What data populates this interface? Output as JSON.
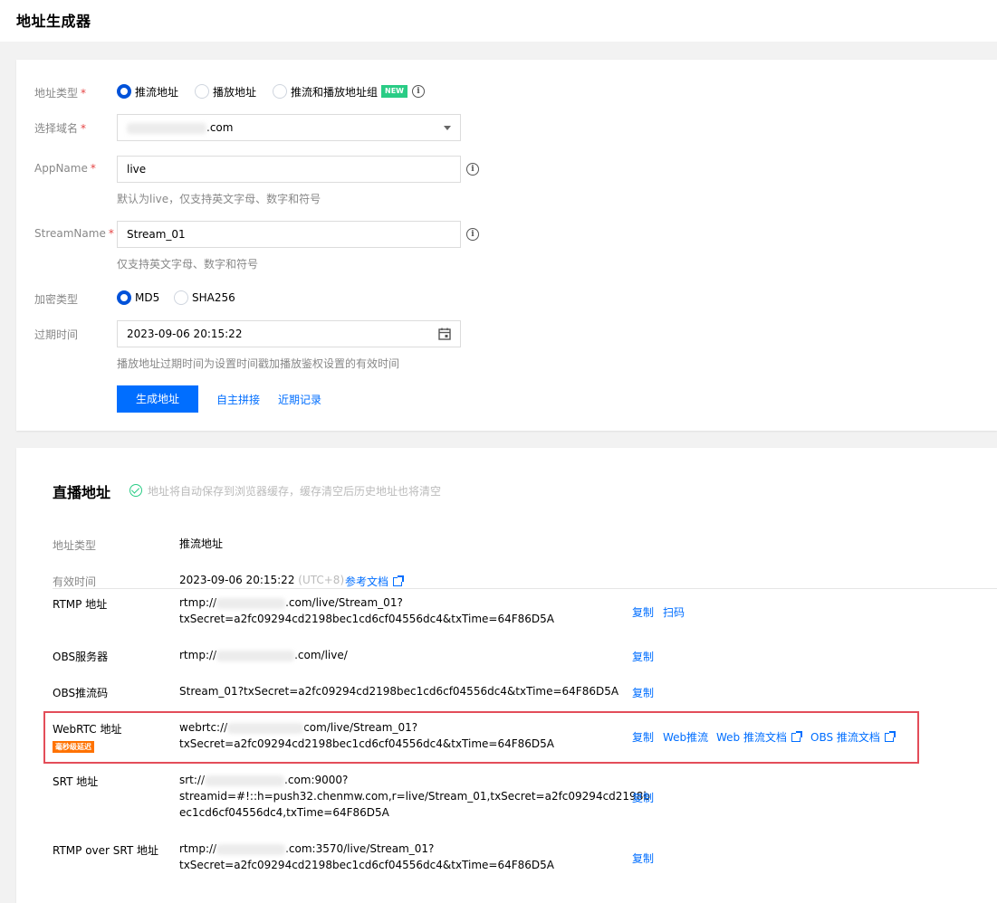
{
  "page": {
    "title": "地址生成器"
  },
  "form": {
    "address_type": {
      "label": "地址类型",
      "options": [
        {
          "label": "推流地址",
          "selected": true
        },
        {
          "label": "播放地址",
          "selected": false
        },
        {
          "label": "推流和播放地址组",
          "selected": false,
          "badge": "NEW"
        }
      ]
    },
    "domain": {
      "label": "选择域名",
      "value_suffix": ".com"
    },
    "app_name": {
      "label": "AppName",
      "value": "live",
      "hint": "默认为live，仅支持英文字母、数字和符号"
    },
    "stream_name": {
      "label": "StreamName",
      "value": "Stream_01",
      "hint": "仅支持英文字母、数字和符号"
    },
    "encryption": {
      "label": "加密类型",
      "options": [
        {
          "label": "MD5",
          "selected": true
        },
        {
          "label": "SHA256",
          "selected": false
        }
      ]
    },
    "expiry": {
      "label": "过期时间",
      "value": "2023-09-06 20:15:22",
      "hint": "播放地址过期时间为设置时间戳加播放鉴权设置的有效时间"
    },
    "generate_button": "生成地址",
    "custom_link": "自主拼接",
    "history_link": "近期记录"
  },
  "live": {
    "title": "直播地址",
    "notice": "地址将自动保存到浏览器缓存，缓存清空后历史地址也将清空",
    "type_label": "地址类型",
    "type_value": "推流地址",
    "valid_label": "有效时间",
    "valid_value": "2023-09-06 20:15:22",
    "valid_tz": "(UTC+8)",
    "ref_doc": "参考文档",
    "rows": [
      {
        "label": "RTMP 地址",
        "line1_prefix": "rtmp://",
        "line1_suffix": ".com/live/Stream_01?",
        "line2": "txSecret=a2fc09294cd2198bec1cd6cf04556dc4&txTime=64F86D5A",
        "copy": "复制",
        "scan": "扫码"
      },
      {
        "label": "OBS服务器",
        "line1_prefix": "rtmp://",
        "line1_suffix": ".com/live/",
        "copy": "复制"
      },
      {
        "label": "OBS推流码",
        "line1": "Stream_01?txSecret=a2fc09294cd2198bec1cd6cf04556dc4&txTime=64F86D5A",
        "copy": "复制"
      },
      {
        "label": "WebRTC 地址",
        "badge": "毫秒级延迟",
        "line1_prefix": "webrtc://",
        "line1_suffix": "com/live/Stream_01?",
        "line2": "txSecret=a2fc09294cd2198bec1cd6cf04556dc4&txTime=64F86D5A",
        "copy": "复制",
        "web_push": "Web推流",
        "web_doc": "Web 推流文档",
        "obs_doc": "OBS 推流文档"
      },
      {
        "label": "SRT 地址",
        "line1_prefix": "srt://",
        "line1_suffix": ".com:9000?",
        "line2": "streamid=#!::h=push32.chenmw.com,r=live/Stream_01,txSecret=a2fc09294cd2198b",
        "line3": "ec1cd6cf04556dc4,txTime=64F86D5A",
        "copy": "复制"
      },
      {
        "label": "RTMP over SRT 地址",
        "line1_prefix": "rtmp://",
        "line1_suffix": ".com:3570/live/Stream_01?",
        "line2": "txSecret=a2fc09294cd2198bec1cd6cf04556dc4&txTime=64F86D5A",
        "copy": "复制"
      }
    ]
  }
}
